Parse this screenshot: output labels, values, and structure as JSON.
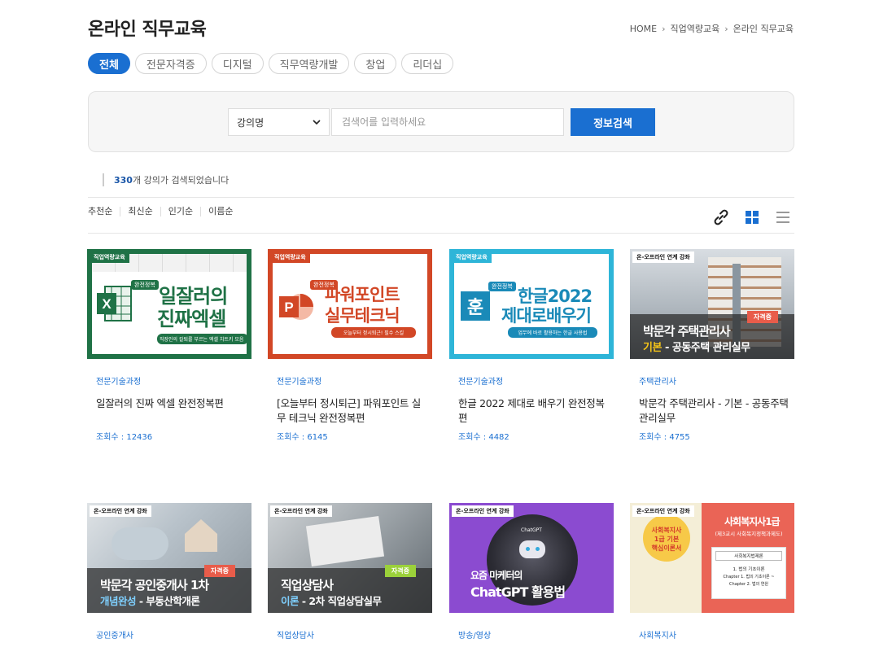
{
  "page": {
    "title": "온라인 직무교육"
  },
  "breadcrumb": [
    "HOME",
    "직업역량교육",
    "온라인 직무교육"
  ],
  "tabs": [
    {
      "label": "전체",
      "active": true
    },
    {
      "label": "전문자격증",
      "active": false
    },
    {
      "label": "디지털",
      "active": false
    },
    {
      "label": "직무역량개발",
      "active": false
    },
    {
      "label": "창업",
      "active": false
    },
    {
      "label": "리더십",
      "active": false
    }
  ],
  "search": {
    "select_value": "강의명",
    "placeholder": "검색어를 입력하세요",
    "button_label": "정보검색"
  },
  "results": {
    "count": "330",
    "text": "개 강의가 검색되었습니다"
  },
  "sort": [
    "추천순",
    "최신순",
    "인기순",
    "이름순"
  ],
  "icons": {
    "link": "link-icon",
    "grid": "grid-view-icon",
    "list": "list-view-icon"
  },
  "colors": {
    "accent": "#1a6fd1",
    "excel": "#1f7246",
    "ppt": "#d24726",
    "hangul": "#2eb5d8",
    "chatgpt": "#8b4bd0"
  },
  "cards": [
    {
      "category": "전문기술과정",
      "title": "일잘러의 진짜 엑셀 완전정복편",
      "views": "조회수 : 12436",
      "thumb": {
        "tag": "직업역량교육",
        "badge": "완전정복",
        "line1": "일잘러의",
        "line2": "진짜엑셀",
        "sub": "직장인의 칼퇴를 부르는 엑셀 치트키 모음"
      }
    },
    {
      "category": "전문기술과정",
      "title": "[오늘부터 정시퇴근] 파워포인트 실무 테크닉 완전정복편",
      "views": "조회수 : 6145",
      "thumb": {
        "tag": "직업역량교육",
        "badge": "완전정복",
        "line1": "파워포인트",
        "line2": "실무테크닉",
        "sub": "오늘부터 정시퇴근! 필수 스킬"
      }
    },
    {
      "category": "전문기술과정",
      "title": "한글 2022 제대로 배우기 완전정복편",
      "views": "조회수 : 4482",
      "thumb": {
        "tag": "직업역량교육",
        "badge": "완전정복",
        "line1": "한글2022",
        "line2": "제대로배우기",
        "sub": "업무에 바로 활용하는 한글 사용법"
      }
    },
    {
      "category": "주택관리사",
      "title": "박문각 주택관리사 - 기본 - 공동주택 관리실무",
      "views": "조회수 : 4755",
      "thumb": {
        "tag": "온-오프라인 연계 강좌",
        "badge": "자격증",
        "line1": "박문각 주택관리사",
        "hl": "기본",
        "line2": " - 공동주택 관리실무"
      }
    },
    {
      "category": "공인중개사",
      "thumb": {
        "tag": "온-오프라인 연계 강좌",
        "badge": "자격증",
        "line1": "박문각 공인중개사 1차",
        "hl": "개념완성",
        "line2": " - 부동산학개론"
      }
    },
    {
      "category": "직업상담사",
      "thumb": {
        "tag": "온-오프라인 연계 강좌",
        "badge": "자격증",
        "line1": "직업상담사",
        "hl": "이론",
        "line2": " - 2차 직업상담실무"
      }
    },
    {
      "category": "방송/영상",
      "thumb": {
        "tag": "온-오프라인 연계 강좌",
        "small": "ChatGPT",
        "line1": "요즘 마케터의",
        "line2": "ChatGPT 활용법"
      }
    },
    {
      "category": "사회복지사",
      "thumb": {
        "tag": "온-오프라인 연계 강좌",
        "line1": "사회복지사1급",
        "sub": "(제3교시 사회복지정책과제도)",
        "book1": "사회복지사",
        "book2": "1급 기본",
        "book3": "핵심이론서",
        "box_title": "사회복지법제론",
        "box1": "1. 법의 기초이론",
        "box2": "Chapter 1. 법의 기초이론 ~",
        "box3": "Chapter 2. 법의 연원"
      }
    }
  ]
}
